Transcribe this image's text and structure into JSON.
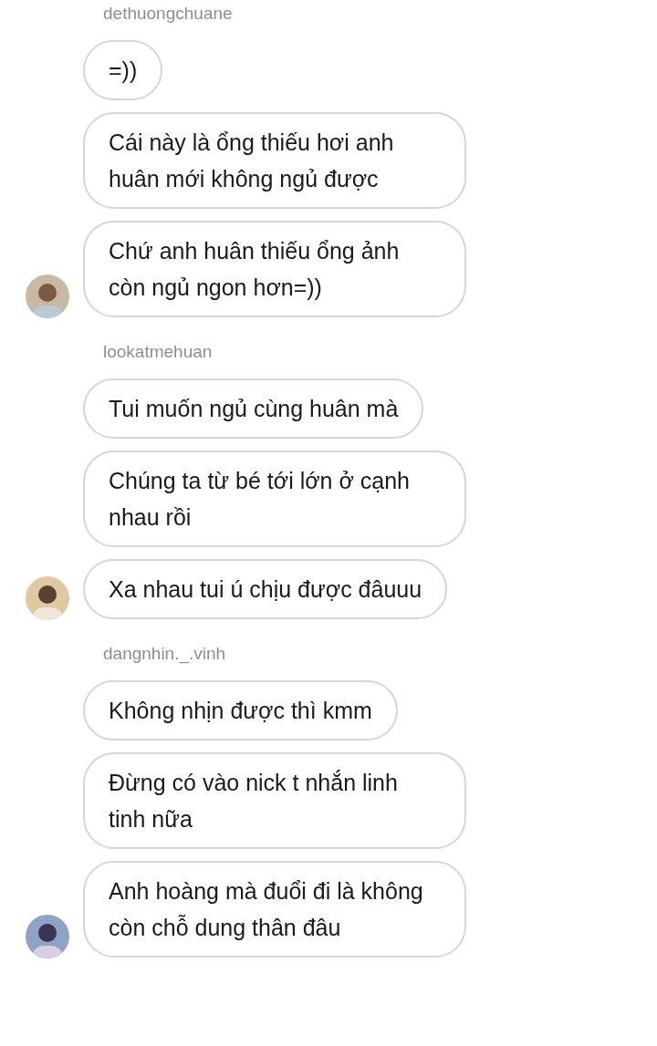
{
  "groups": [
    {
      "sender": "dethuongchuane",
      "messages": [
        "=))",
        "Cái này là ổng thiếu hơi anh huân mới không ngủ được",
        "Chứ anh huân thiếu ổng ảnh còn ngủ ngon hơn=))"
      ]
    },
    {
      "sender": "lookatmehuan",
      "messages": [
        "Tui muốn ngủ cùng huân mà",
        "Chúng ta từ bé tới lớn ở cạnh nhau rồi",
        "Xa nhau tui ú chịu được đâuuu"
      ]
    },
    {
      "sender": "dangnhin._.vinh",
      "messages": [
        "Không nhịn được thì kmm",
        "Đừng có vào nick t nhắn linh tinh nữa",
        "Anh hoàng mà đuổi đi là không còn chỗ dung thân đâu"
      ]
    }
  ]
}
